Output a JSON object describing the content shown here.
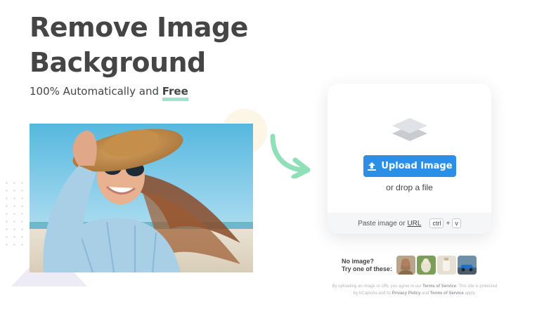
{
  "hero": {
    "title_line1": "Remove Image",
    "title_line2": "Background",
    "subtitle_prefix": "100% Automatically and ",
    "subtitle_highlight": "Free"
  },
  "upload": {
    "button_label": "Upload Image",
    "drop_text": "or drop a file",
    "paste_prefix": "Paste image or",
    "paste_url": "URL",
    "kbd_ctrl": "ctrl",
    "kbd_plus": "+",
    "kbd_v": "v"
  },
  "samples": {
    "label_line1": "No image?",
    "label_line2": "Try one of these:"
  },
  "legal": {
    "text1": "By uploading an image or URL you agree to our ",
    "tos": "Terms of Service",
    "text2": ". This site is protected by hCaptcha and its ",
    "privacy": "Privacy Policy",
    "text3": " and ",
    "tos2": "Terms of Service",
    "text4": " apply."
  },
  "colors": {
    "accent_blue": "#2b8fe8",
    "highlight_green": "#9ae6c8",
    "heading": "#454545"
  },
  "icons": {
    "card": "layers-icon",
    "button": "upload-arrow-icon",
    "decor": "curved-arrow-icon"
  }
}
